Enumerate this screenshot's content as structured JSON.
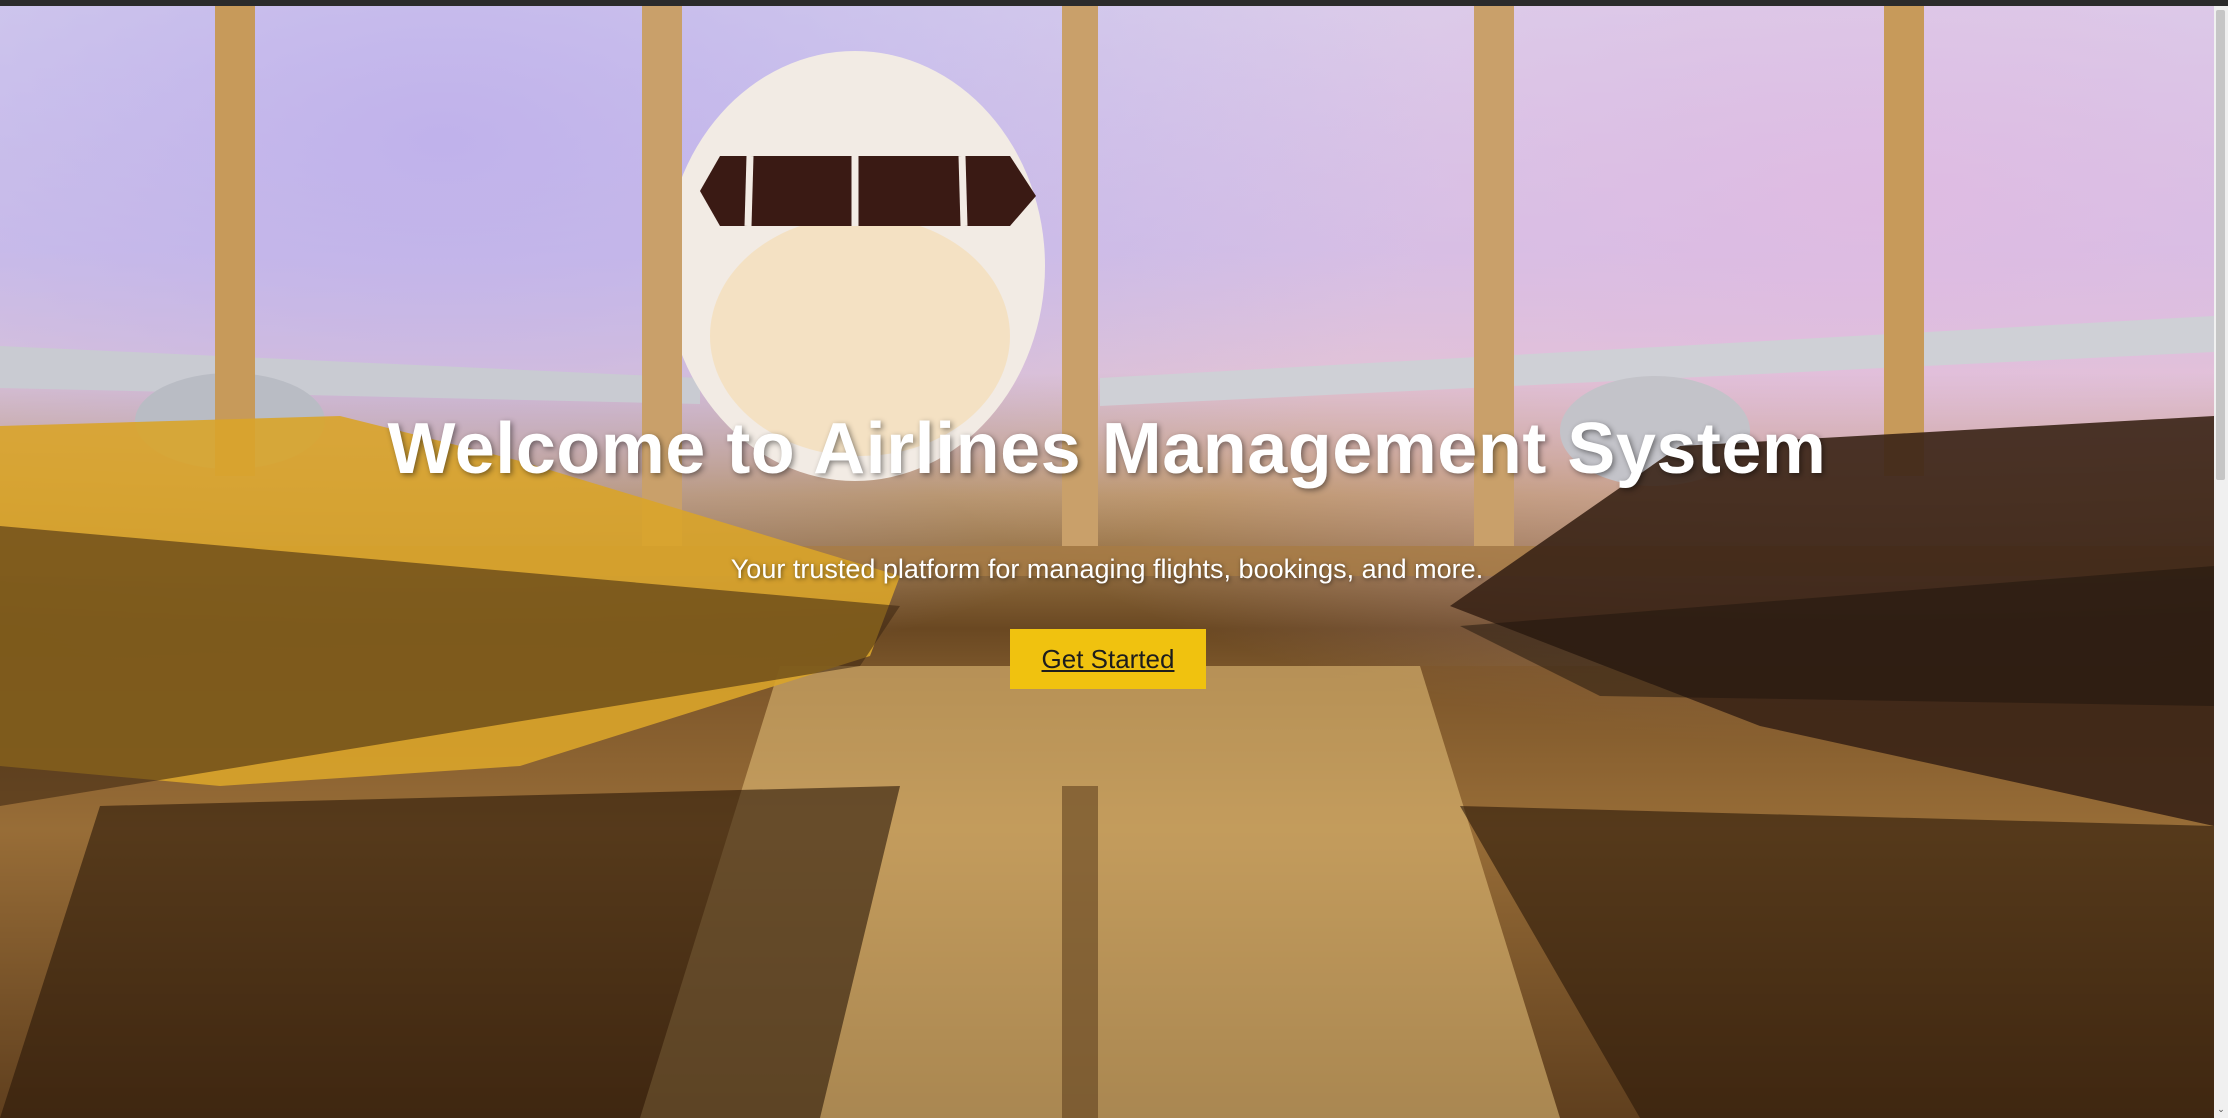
{
  "hero": {
    "title": "Welcome to Airlines Management System",
    "subtitle": "Your trusted platform for managing flights, bookings, and more.",
    "cta_label": "Get Started"
  },
  "colors": {
    "cta_background": "#f0c20f",
    "text": "#ffffff"
  },
  "scrollbar": {
    "down_arrow": "⌄"
  }
}
